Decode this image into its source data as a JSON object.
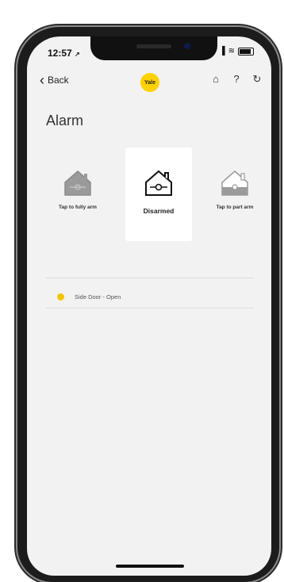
{
  "status_bar": {
    "time": "12:57",
    "location_glyph": "↗",
    "signal_glyph": "▐",
    "wifi_glyph": "≋"
  },
  "nav": {
    "back_chevron": "‹",
    "back_label": "Back",
    "logo_text": "Yale",
    "home_glyph": "⌂",
    "help_glyph": "?",
    "history_glyph": "↻"
  },
  "page": {
    "title": "Alarm"
  },
  "modes": [
    {
      "label": "Tap to fully arm",
      "icon": "house-armed-icon",
      "active": false
    },
    {
      "label": "Disarmed",
      "icon": "house-disarmed-icon",
      "active": true
    },
    {
      "label": "Tap to part arm",
      "icon": "house-part-armed-icon",
      "active": false
    }
  ],
  "sensors": [
    {
      "label": "Side Door - Open",
      "status_color": "#f5c400"
    }
  ],
  "colors": {
    "accent": "#ffd100",
    "background": "#f2f2f2",
    "card": "#ffffff"
  }
}
